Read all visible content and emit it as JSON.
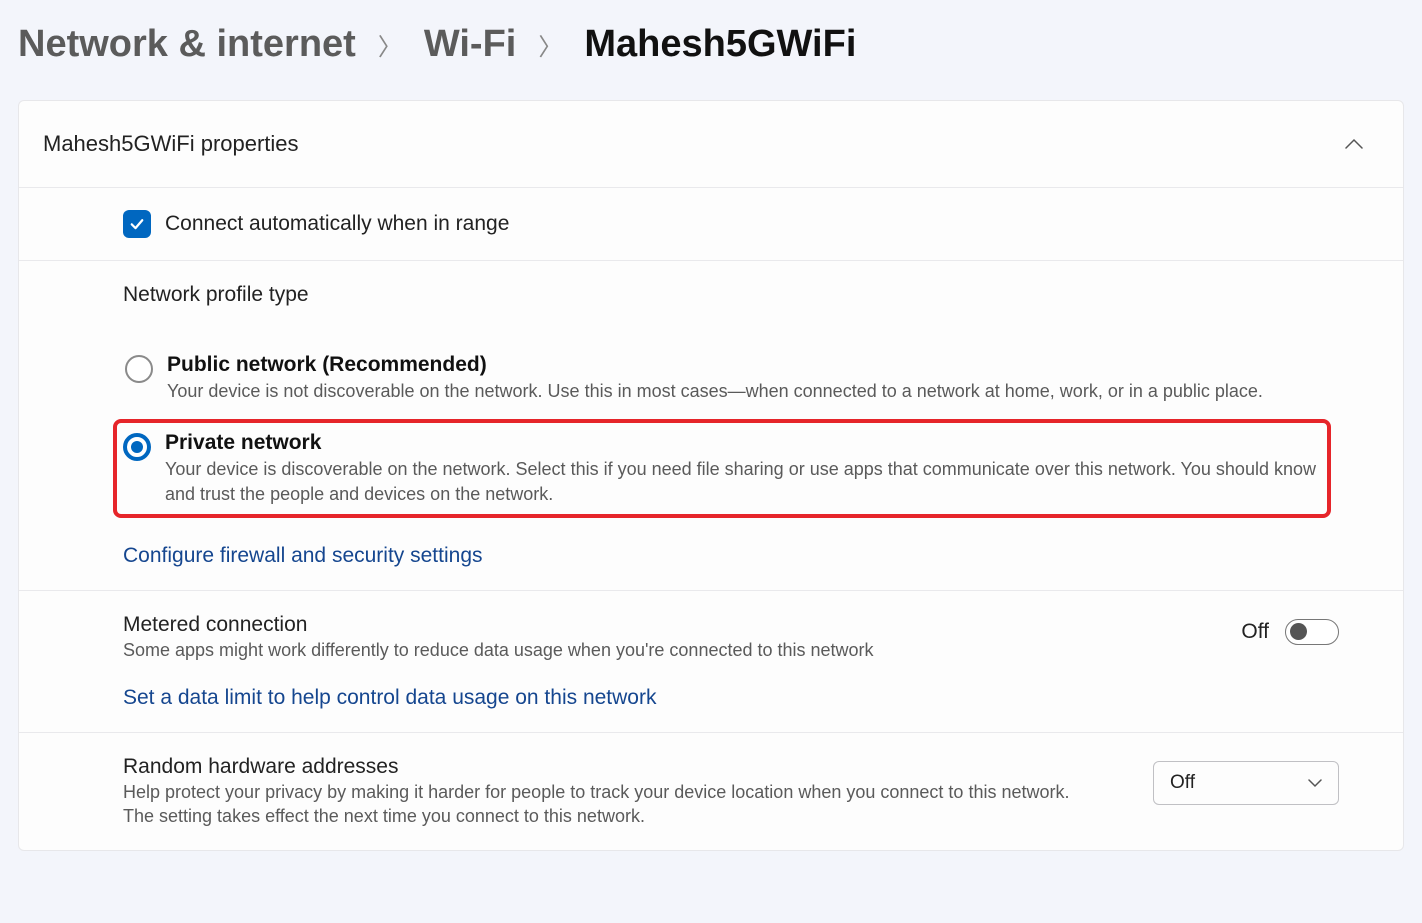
{
  "breadcrumb": {
    "level1": "Network & internet",
    "level2": "Wi-Fi",
    "level3": "Mahesh5GWiFi"
  },
  "panel": {
    "title": "Mahesh5GWiFi properties"
  },
  "connect_auto": {
    "label": "Connect automatically when in range"
  },
  "profile": {
    "title": "Network profile type",
    "public": {
      "title": "Public network (Recommended)",
      "desc": "Your device is not discoverable on the network. Use this in most cases—when connected to a network at home, work, or in a public place."
    },
    "private": {
      "title": "Private network",
      "desc": "Your device is discoverable on the network. Select this if you need file sharing or use apps that communicate over this network. You should know and trust the people and devices on the network."
    },
    "firewall_link": "Configure firewall and security settings"
  },
  "metered": {
    "title": "Metered connection",
    "desc": "Some apps might work differently to reduce data usage when you're connected to this network",
    "toggle_label": "Off",
    "data_limit_link": "Set a data limit to help control data usage on this network"
  },
  "random": {
    "title": "Random hardware addresses",
    "desc": "Help protect your privacy by making it harder for people to track your device location when you connect to this network. The setting takes effect the next time you connect to this network.",
    "dropdown_value": "Off"
  }
}
